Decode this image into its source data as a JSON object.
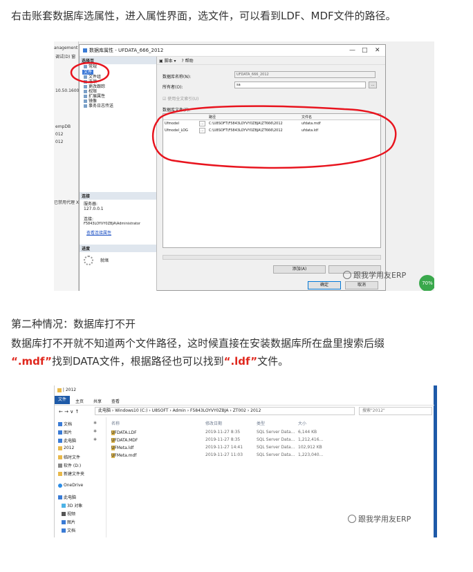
{
  "paragraphs": {
    "p1": "右击账套数据库选属性，进入属性界面，选文件，可以看到LDF、MDF文件的路径。",
    "p2": "第二种情况：数据库打不开",
    "p3": "数据库打不开就不知道两个文件路径，这时候直接在安装数据库所在盘里搜索后缀",
    "p4_a": "“.mdf”",
    "p4_b": "找到DATA文件，根据路径也可以找到",
    "p4_c": "“.ldf”",
    "p4_d": "文件。"
  },
  "colors": {
    "accent_red": "#e0281e",
    "annotation_circle": "#e8141e",
    "select_blue": "#3a78d8"
  },
  "shot1": {
    "ssms": {
      "t1": "anagement S",
      "t2": "调试(D) 窗",
      "t3": "10.50.1600",
      "t4": "empDB",
      "t5": "012",
      "t6": "012",
      "t7": "已禁用代理 XP"
    },
    "dialog_title": "数据库属性 - UFDATA_666_2012",
    "controls": {
      "minimize": "—",
      "maximize": "□",
      "close": "✕"
    },
    "select_page_header": "选择页",
    "pages": [
      "常规",
      "文件",
      "文件组",
      "选项",
      "更改跟踪",
      "权限",
      "扩展属性",
      "镜像",
      "事务日志传送"
    ],
    "selected_page": "文件",
    "connection": {
      "header": "连接",
      "server_label": "服务器:",
      "server": "127.0.0.1",
      "conn_label": "连接:",
      "conn": "F5843LOYVY0ZBJA\\Administrator",
      "view_link": "查看连接属性"
    },
    "progress": {
      "header": "进度",
      "status": "就绪"
    },
    "toolbar": {
      "script": "脚本",
      "help": "帮助"
    },
    "db_name_label": "数据库名称(N):",
    "db_name": "UFDATA_666_2012",
    "owner_label": "所有者(O):",
    "owner": "sa",
    "browse": "...",
    "fulltext_label": "使用全文索引(U)",
    "files_label": "数据库文件(F):",
    "grid_headers": {
      "path": "路径",
      "filename": "文件名"
    },
    "rows": [
      {
        "name": "Ufmodel",
        "path": "C:\\U8SOFT\\F5843LOYVY0ZBJA\\ZT666\\2012",
        "file": "ufdata.mdf"
      },
      {
        "name": "Ufmodel_LOG",
        "path": "C:\\U8SOFT\\F5843LOYVY0ZBJA\\ZT666\\2012",
        "file": "ufdata.ldf"
      }
    ],
    "add_button": "添加(A)",
    "ok_button": "确定",
    "cancel_button": "取消",
    "badge": "70%",
    "watermark": "跟我学用友ERP"
  },
  "shot2": {
    "quick_title": "2012",
    "ribbon_tabs": [
      "文件",
      "主页",
      "共享",
      "查看"
    ],
    "address": [
      "此电脑",
      "Windows10 (C:)",
      "U8SOFT",
      "Admin",
      "F5843LOYVY0ZBJA",
      "ZT002",
      "2012"
    ],
    "search_placeholder": "搜索\"2012\"",
    "nav": [
      {
        "label": "文档",
        "pinned": true
      },
      {
        "label": "图片",
        "pinned": true
      },
      {
        "label": "此电脑",
        "pinned": true
      },
      {
        "label": "2012",
        "pinned": false
      },
      {
        "label": "临时文件",
        "pinned": false
      },
      {
        "label": "软件 (D:)",
        "pinned": false
      },
      {
        "label": "新建文件夹",
        "pinned": false
      },
      {
        "label": "OneDrive",
        "pinned": false
      },
      {
        "label": "此电脑",
        "pinned": false
      },
      {
        "label": "3D 对象",
        "pinned": false
      },
      {
        "label": "视频",
        "pinned": false
      },
      {
        "label": "图片",
        "pinned": false
      },
      {
        "label": "文档",
        "pinned": false
      }
    ],
    "columns": {
      "name": "名称",
      "date": "修改日期",
      "type": "类型",
      "size": "大小"
    },
    "files": [
      {
        "name": "UFDATA.LDF",
        "date": "2019-11-27 8:35",
        "type": "SQL Server Data...",
        "size": "6,144 KB"
      },
      {
        "name": "UFDATA.MDF",
        "date": "2019-11-27 8:35",
        "type": "SQL Server Data...",
        "size": "1,212,416..."
      },
      {
        "name": "UFMeta.ldf",
        "date": "2019-11-27 14:41",
        "type": "SQL Server Data...",
        "size": "102,912 KB"
      },
      {
        "name": "UFMeta.mdf",
        "date": "2019-11-27 11:03",
        "type": "SQL Server Data...",
        "size": "1,223,040..."
      }
    ],
    "watermark": "跟我学用友ERP"
  }
}
